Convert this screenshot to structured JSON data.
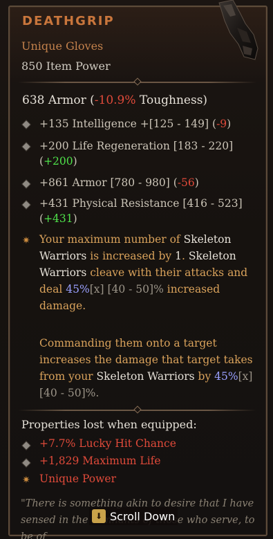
{
  "item": {
    "name": "DEATHGRIP",
    "type": "Unique Gloves",
    "item_power": "850 Item Power",
    "icon": "gauntlet-icon"
  },
  "armor_line": {
    "value": "638 Armor (",
    "delta": "-10.9%",
    "suffix": " Toughness)"
  },
  "stats": [
    {
      "main": "+135 Intelligence +[125 - 149] (",
      "delta": "-9",
      "delta_color": "red",
      "close": ")"
    },
    {
      "main": "+200 Life Regeneration [183 - 220] (",
      "delta": "+200",
      "delta_color": "green",
      "close": ")"
    },
    {
      "main": "+861 Armor [780 - 980] (",
      "delta": "-56",
      "delta_color": "red",
      "close": ")"
    },
    {
      "main": "+431 Physical Resistance [416 - 523] (",
      "delta": "+431",
      "delta_color": "green",
      "close": ")"
    }
  ],
  "unique_power": {
    "p1_a": "Your maximum number of ",
    "p1_b": "Skeleton Warriors",
    "p1_c": " is increased by ",
    "p1_d": "1",
    "p1_e": ". ",
    "p1_f": "Skeleton Warriors",
    "p1_g": " cleave with their attacks and deal ",
    "p1_h": "45%",
    "p1_i": "[x] [40 - 50]%",
    "p1_j": " increased damage.",
    "p2_a": "Commanding them onto a target increases the damage that target takes from your ",
    "p2_b": "Skeleton Warriors",
    "p2_c": " by ",
    "p2_d": "45%",
    "p2_e": "[x] [40 - 50]%."
  },
  "properties_lost": {
    "title": "Properties lost when equipped:",
    "items": [
      "+7.7% Lucky Hit Chance",
      "+1,829 Maximum Life",
      "Unique Power"
    ]
  },
  "flavor_text": "\"There is something akin to desire that I have sensed in the remnants of those who serve, to be of",
  "scroll": {
    "label": "Scroll Down",
    "icon": "scroll-down-icon"
  },
  "colors": {
    "title": "#c9763c",
    "unique": "#d9a25b",
    "negative": "#e04a3a",
    "positive": "#4fe14a",
    "highlight": "#9aa0ff"
  }
}
